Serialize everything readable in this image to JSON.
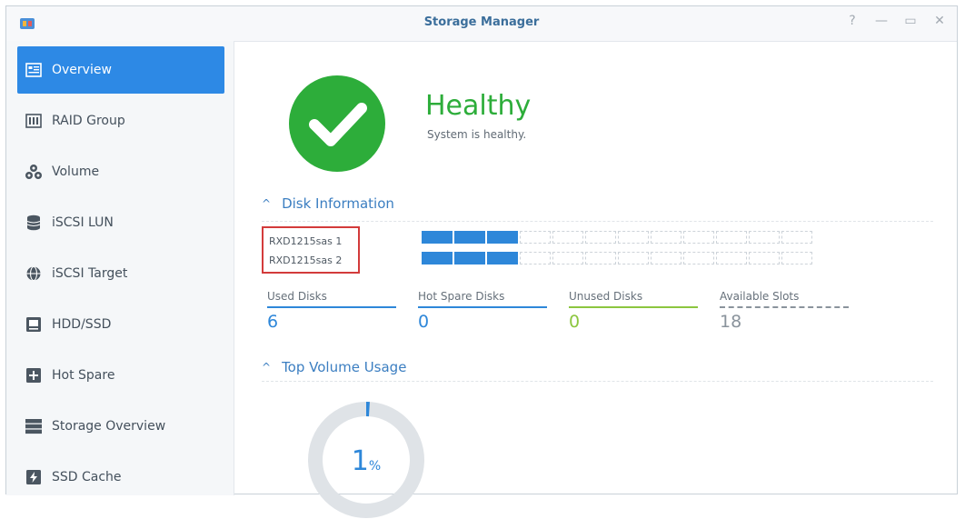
{
  "window": {
    "title": "Storage Manager",
    "controls": [
      "?",
      "—",
      "▭",
      "✕"
    ]
  },
  "sidebar": {
    "items": [
      {
        "label": "Overview",
        "icon": "overview-icon",
        "active": true
      },
      {
        "label": "RAID Group",
        "icon": "raid-icon",
        "active": false
      },
      {
        "label": "Volume",
        "icon": "volume-icon",
        "active": false
      },
      {
        "label": "iSCSI LUN",
        "icon": "lun-icon",
        "active": false
      },
      {
        "label": "iSCSI Target",
        "icon": "globe-icon",
        "active": false
      },
      {
        "label": "HDD/SSD",
        "icon": "hdd-icon",
        "active": false
      },
      {
        "label": "Hot Spare",
        "icon": "hot-spare-icon",
        "active": false
      },
      {
        "label": "Storage Overview",
        "icon": "storage-icon",
        "active": false
      },
      {
        "label": "SSD Cache",
        "icon": "ssd-cache-icon",
        "active": false
      }
    ]
  },
  "health": {
    "status": "Healthy",
    "message": "System is healthy."
  },
  "disk_info": {
    "header": "Disk Information",
    "units": [
      {
        "name": "RXD1215sas 1",
        "used_slots": 3,
        "total_slots": 12
      },
      {
        "name": "RXD1215sas 2",
        "used_slots": 3,
        "total_slots": 12
      }
    ],
    "stats": [
      {
        "label": "Used Disks",
        "value": "6",
        "color": "#2e87d9",
        "dashed": false
      },
      {
        "label": "Hot Spare Disks",
        "value": "0",
        "color": "#2e87d9",
        "dashed": false
      },
      {
        "label": "Unused Disks",
        "value": "0",
        "color": "#8cc63f",
        "dashed": false
      },
      {
        "label": "Available Slots",
        "value": "18",
        "color": "#8a939c",
        "dashed": true
      }
    ]
  },
  "volume_usage": {
    "header": "Top Volume Usage",
    "percent_number": "1",
    "percent_sign": "%",
    "percent": 1
  },
  "colors": {
    "accent": "#2d89e5",
    "healthy": "#2dad3a"
  }
}
